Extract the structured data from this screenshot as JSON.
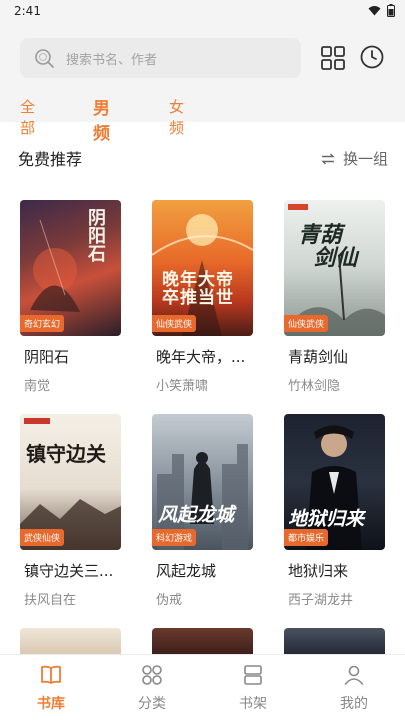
{
  "status": {
    "time": "2:41"
  },
  "search": {
    "placeholder": "搜索书名、作者"
  },
  "tabs": [
    {
      "label": "全部",
      "active": false
    },
    {
      "label": "男频",
      "active": true
    },
    {
      "label": "女频",
      "active": false
    }
  ],
  "section": {
    "title": "免费推荐",
    "refresh_label": "换一组"
  },
  "books": [
    {
      "name": "阴阳石",
      "author": "南觉",
      "tag": "奇幻玄幻",
      "cover_title": "阴阳石"
    },
    {
      "name": "晚年大帝，...",
      "author": "小笑萧啸",
      "tag": "仙侠武侠",
      "cover_title": "晚年大帝卒推当世"
    },
    {
      "name": "青葫剑仙",
      "author": "竹林剑隐",
      "tag": "仙侠武侠",
      "cover_title": "青葫剑仙"
    },
    {
      "name": "镇守边关三...",
      "author": "扶风自在",
      "tag": "武侠仙侠",
      "cover_title": "镇守边关"
    },
    {
      "name": "风起龙城",
      "author": "伪戒",
      "tag": "科幻游戏",
      "cover_title": "风起龙城"
    },
    {
      "name": "地狱归来",
      "author": "西子湖龙井",
      "tag": "都市娱乐",
      "cover_title": "地狱归来"
    }
  ],
  "bottom_nav": [
    {
      "label": "书库",
      "icon": "book-icon",
      "active": true
    },
    {
      "label": "分类",
      "icon": "category-icon",
      "active": false
    },
    {
      "label": "书架",
      "icon": "bookshelf-icon",
      "active": false
    },
    {
      "label": "我的",
      "icon": "profile-icon",
      "active": false
    }
  ],
  "colors": {
    "accent": "#ef7e35",
    "tag": "#e8692d",
    "background_top": "#f4f4f4"
  }
}
